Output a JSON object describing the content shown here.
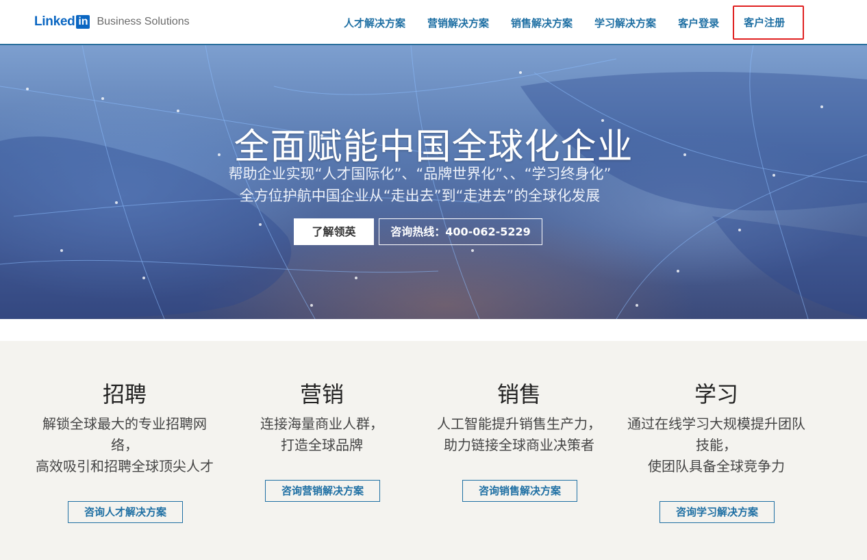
{
  "brand": {
    "word": "Linked",
    "box": "in",
    "sub": "Business Solutions"
  },
  "nav": {
    "items": [
      "人才解决方案",
      "营销解决方案",
      "销售解决方案",
      "学习解决方案",
      "客户登录"
    ],
    "register": "客户注册"
  },
  "hero": {
    "title": "全面赋能中国全球化企业",
    "subtitle_line1": "帮助企业实现“人才国际化”、“品牌世界化”、、“学习终身化”",
    "subtitle_line2": "全方位护航中国企业从“走出去”到“走进去”的全球化发展",
    "primary_button": "了解领英",
    "hotline_button": "咨询热线：400-062-5229"
  },
  "solutions": [
    {
      "title": "招聘",
      "desc": [
        "解锁全球最大的专业招聘网",
        "络，",
        "高效吸引和招聘全球顶尖人才"
      ],
      "button": "咨询人才解决方案"
    },
    {
      "title": "营销",
      "desc": [
        "连接海量商业人群，",
        "打造全球品牌"
      ],
      "button": "咨询营销解决方案"
    },
    {
      "title": "销售",
      "desc": [
        "人工智能提升销售生产力，",
        "助力链接全球商业决策者"
      ],
      "button": "咨询销售解决方案"
    },
    {
      "title": "学习",
      "desc": [
        "通过在线学习大规模提升团队",
        "技能，",
        "使团队具备全球竞争力"
      ],
      "button": "咨询学习解决方案"
    }
  ],
  "colors": {
    "accent": "#1e6fa3",
    "brand": "#0a66c2",
    "highlight": "#e02020"
  }
}
